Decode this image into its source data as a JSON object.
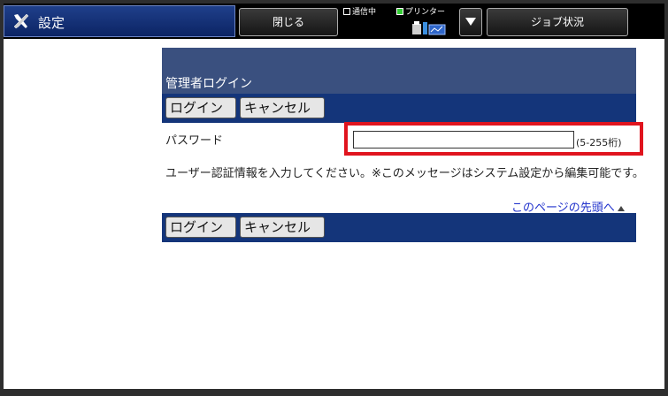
{
  "topbar": {
    "settings_label": "設定",
    "close_label": "閉じる",
    "status_comm": "通信中",
    "status_printer": "プリンター",
    "job_label": "ジョブ状況"
  },
  "page": {
    "title": "管理者ログイン",
    "login_label": "ログイン",
    "cancel_label": "キャンセル",
    "password_label": "パスワード",
    "password_value": "",
    "password_hint": "(5-255桁)",
    "message": "ユーザー認証情報を入力してください。※このメッセージはシステム設定から編集可能です。",
    "top_link": "このページの先頭へ"
  },
  "colors": {
    "highlight": "#e0141e",
    "header_panel": "#3a507f",
    "action_bar": "#14357a",
    "settings_tab": "#0c2464"
  }
}
